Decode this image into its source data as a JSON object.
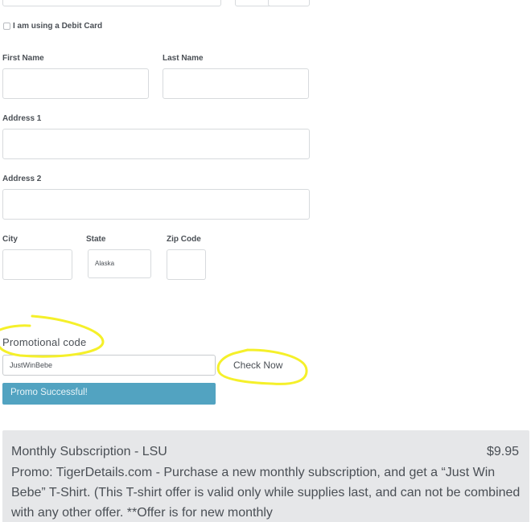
{
  "form": {
    "debit_card_label": "I am using a Debit Card",
    "debit_card_checked": false,
    "first_name_label": "First Name",
    "first_name_value": "",
    "last_name_label": "Last Name",
    "last_name_value": "",
    "address1_label": "Address 1",
    "address1_value": "",
    "address2_label": "Address 2",
    "address2_value": "",
    "city_label": "City",
    "city_value": "",
    "state_label": "State",
    "state_value": "Alaska",
    "zip_label": "Zip Code",
    "zip_value": ""
  },
  "promo": {
    "label": "Promotional code",
    "code_value": "JustWinBebe",
    "check_button": "Check Now",
    "status_message": "Promo Successful!",
    "status_color": "#52a3c1",
    "highlight_color": "#f5f02a"
  },
  "summary": {
    "title": "Monthly Subscription - LSU",
    "price": "$9.95",
    "description": "Promo: TigerDetails.com - Purchase a new monthly subscription, and get a “Just Win Bebe” T-Shirt. (This T-shirt offer is valid only while supplies last, and can not be combined with any other offer. **Offer is for new monthly"
  }
}
